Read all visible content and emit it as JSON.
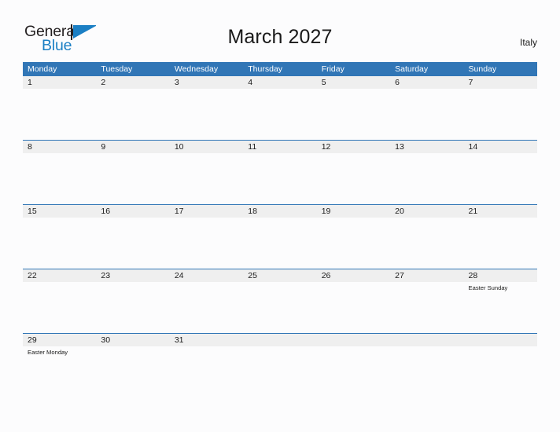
{
  "brand": {
    "name_part1": "General",
    "name_part2": "Blue",
    "flag_icon": "flag-triangle-icon",
    "accent_color": "#1b7fc4"
  },
  "header": {
    "title": "March 2027",
    "country": "Italy"
  },
  "theme": {
    "header_blue": "#3176b6",
    "row_gray": "#efefef",
    "page_background": "#fcfcfd",
    "separator_blue": "#3176b6",
    "text_color": "#1a1a1a"
  },
  "calendar": {
    "weekdays": [
      "Monday",
      "Tuesday",
      "Wednesday",
      "Thursday",
      "Friday",
      "Saturday",
      "Sunday"
    ],
    "weeks": [
      {
        "days": [
          {
            "number": "1",
            "events": []
          },
          {
            "number": "2",
            "events": []
          },
          {
            "number": "3",
            "events": []
          },
          {
            "number": "4",
            "events": []
          },
          {
            "number": "5",
            "events": []
          },
          {
            "number": "6",
            "events": []
          },
          {
            "number": "7",
            "events": []
          }
        ]
      },
      {
        "days": [
          {
            "number": "8",
            "events": []
          },
          {
            "number": "9",
            "events": []
          },
          {
            "number": "10",
            "events": []
          },
          {
            "number": "11",
            "events": []
          },
          {
            "number": "12",
            "events": []
          },
          {
            "number": "13",
            "events": []
          },
          {
            "number": "14",
            "events": []
          }
        ]
      },
      {
        "days": [
          {
            "number": "15",
            "events": []
          },
          {
            "number": "16",
            "events": []
          },
          {
            "number": "17",
            "events": []
          },
          {
            "number": "18",
            "events": []
          },
          {
            "number": "19",
            "events": []
          },
          {
            "number": "20",
            "events": []
          },
          {
            "number": "21",
            "events": []
          }
        ]
      },
      {
        "days": [
          {
            "number": "22",
            "events": []
          },
          {
            "number": "23",
            "events": []
          },
          {
            "number": "24",
            "events": []
          },
          {
            "number": "25",
            "events": []
          },
          {
            "number": "26",
            "events": []
          },
          {
            "number": "27",
            "events": []
          },
          {
            "number": "28",
            "events": [
              "Easter Sunday"
            ]
          }
        ]
      },
      {
        "days": [
          {
            "number": "29",
            "events": [
              "Easter Monday"
            ]
          },
          {
            "number": "30",
            "events": []
          },
          {
            "number": "31",
            "events": []
          },
          {
            "number": "",
            "events": []
          },
          {
            "number": "",
            "events": []
          },
          {
            "number": "",
            "events": []
          },
          {
            "number": "",
            "events": []
          }
        ]
      }
    ]
  }
}
